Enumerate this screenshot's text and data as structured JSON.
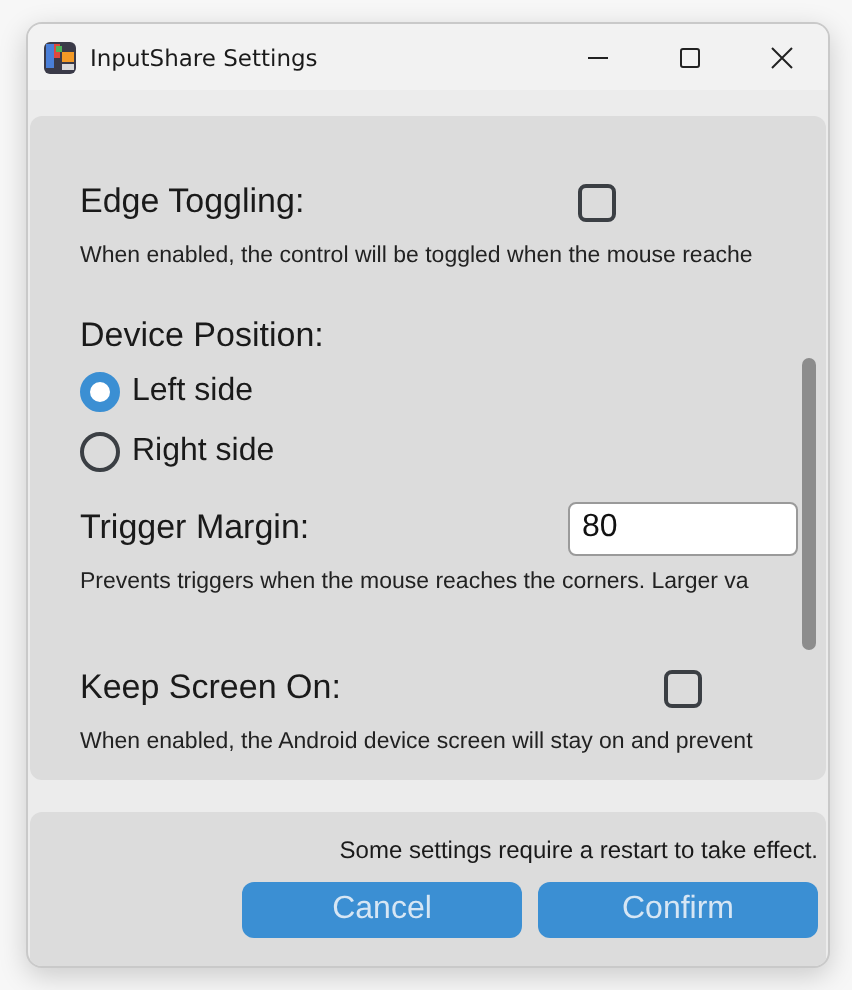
{
  "window": {
    "title": "InputShare Settings"
  },
  "settings": [
    {
      "kind": "checkbox",
      "label": "Edge Toggling:",
      "checked": false,
      "description": "When enabled, the control will be toggled when the mouse reache"
    },
    {
      "kind": "radio",
      "label": "Device Position:",
      "options": [
        {
          "label": "Left side",
          "selected": true
        },
        {
          "label": "Right side",
          "selected": false
        }
      ]
    },
    {
      "kind": "number",
      "label": "Trigger Margin:",
      "value": "80",
      "description": "Prevents triggers when the mouse reaches the corners. Larger va"
    },
    {
      "kind": "checkbox",
      "label": "Keep Screen On:",
      "checked": false,
      "description": "When enabled, the Android device screen will stay on and prevent"
    }
  ],
  "footer": {
    "note": "Some settings require a restart to take effect.",
    "buttons": [
      "Cancel",
      "Confirm"
    ]
  }
}
